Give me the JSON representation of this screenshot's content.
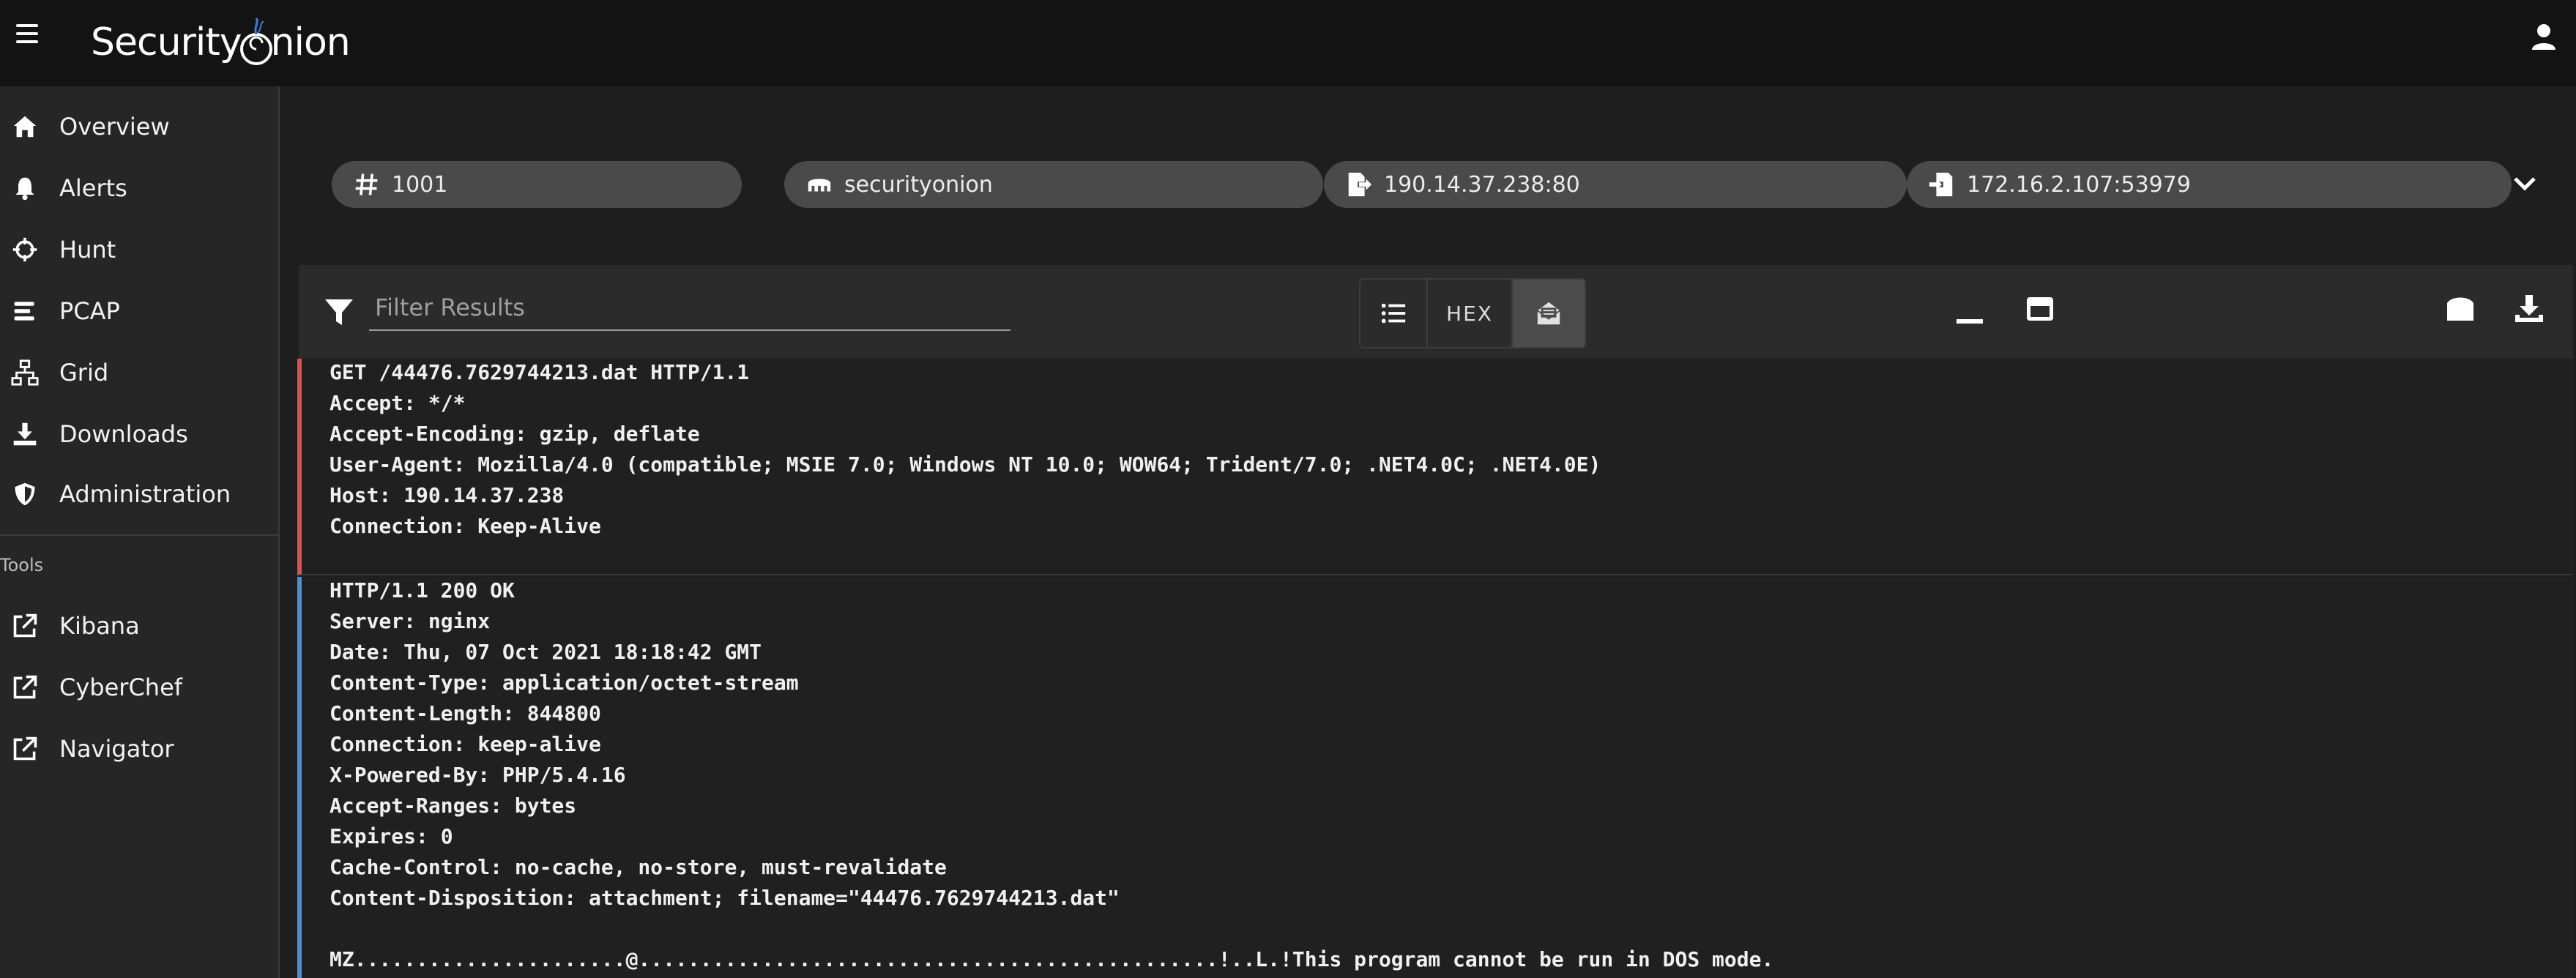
{
  "app": {
    "brand_prefix": "Security",
    "brand_suffix": "nion"
  },
  "sidebar": {
    "items": [
      {
        "label": "Overview",
        "icon": "home-icon"
      },
      {
        "label": "Alerts",
        "icon": "bell-icon"
      },
      {
        "label": "Hunt",
        "icon": "crosshairs-icon"
      },
      {
        "label": "PCAP",
        "icon": "list-bars-icon"
      },
      {
        "label": "Grid",
        "icon": "network-icon"
      },
      {
        "label": "Downloads",
        "icon": "download-icon"
      },
      {
        "label": "Administration",
        "icon": "shield-icon"
      }
    ],
    "tools_header": "Tools",
    "tools": [
      {
        "label": "Kibana",
        "icon": "external-link-icon"
      },
      {
        "label": "CyberChef",
        "icon": "external-link-icon"
      },
      {
        "label": "Navigator",
        "icon": "external-link-icon"
      }
    ]
  },
  "header": {
    "tags": [
      {
        "label": "1001",
        "icon": "hash-icon"
      },
      {
        "label": "securityonion",
        "icon": "sensor-icon"
      },
      {
        "label": "190.14.37.238:80",
        "icon": "file-export-icon"
      },
      {
        "label": "172.16.2.107:53979",
        "icon": "file-import-icon"
      }
    ]
  },
  "toolbar": {
    "filter_placeholder": "Filter Results",
    "hex_label": "HEX",
    "active_view": "unwrap"
  },
  "stream": {
    "client": [
      "GET /44476.7629744213.dat HTTP/1.1",
      "Accept: */*",
      "Accept-Encoding: gzip, deflate",
      "User-Agent: Mozilla/4.0 (compatible; MSIE 7.0; Windows NT 10.0; WOW64; Trident/7.0; .NET4.0C; .NET4.0E)",
      "Host: 190.14.37.238",
      "Connection: Keep-Alive"
    ],
    "server": [
      "HTTP/1.1 200 OK",
      "Server: nginx",
      "Date: Thu, 07 Oct 2021 18:18:42 GMT",
      "Content-Type: application/octet-stream",
      "Content-Length: 844800",
      "Connection: keep-alive",
      "X-Powered-By: PHP/5.4.16",
      "Accept-Ranges: bytes",
      "Expires: 0",
      "Cache-Control: no-cache, no-store, must-revalidate",
      "Content-Disposition: attachment; filename=\"44476.7629744213.dat\"",
      "",
      "MZ......................@...............................................!..L.!This program cannot be run in DOS mode."
    ]
  },
  "colors": {
    "client_marker": "#d9534f",
    "server_marker": "#4a90d9",
    "topbar_bg": "#131313",
    "sidebar_bg": "#262626",
    "tag_bg": "#4a4a4a"
  }
}
